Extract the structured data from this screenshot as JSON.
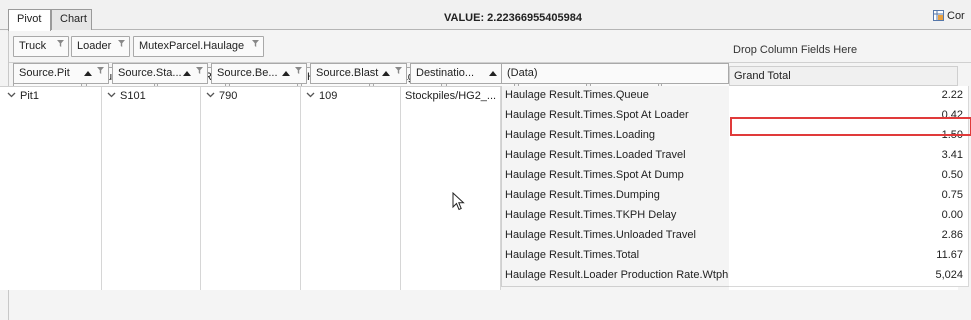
{
  "tabs": [
    {
      "label": "Pivot",
      "active": true
    },
    {
      "label": "Chart",
      "active": false
    }
  ],
  "value_label": "VALUE: 2.22366955405984",
  "config_button": "Cor",
  "filter_fields": [
    "Truck",
    "Loader",
    "MutexParcel.Haulage"
  ],
  "haulage_fields": [
    "HaulageR...",
    "HaulageR...",
    "HaulageR...",
    "HaulageR...",
    "HaulageR...",
    "HaulageR...",
    "HaulageR...",
    "HaulageR...",
    "HaulageR...",
    "HaulageR..."
  ],
  "drop_column_hint": "Drop Column Fields Here",
  "row_fields": [
    "Source.Pit",
    "Source.Sta...",
    "Source.Be...",
    "Source.Blast",
    "Destinatio..."
  ],
  "data_header": "(Data)",
  "grand_total_header": "Grand Total",
  "row_values": {
    "pit": "Pit1",
    "stage": "S101",
    "bench": "790",
    "blast": "109",
    "destination": "Stockpiles/HG2_..."
  },
  "data_rows": [
    {
      "label": "Haulage Result.Times.Queue",
      "value": "2.22"
    },
    {
      "label": "Haulage Result.Times.Spot At Loader",
      "value": "0.42"
    },
    {
      "label": "Haulage Result.Times.Loading",
      "value": "1.50"
    },
    {
      "label": "Haulage Result.Times.Loaded Travel",
      "value": "3.41"
    },
    {
      "label": "Haulage Result.Times.Spot At Dump",
      "value": "0.50"
    },
    {
      "label": "Haulage Result.Times.Dumping",
      "value": "0.75"
    },
    {
      "label": "Haulage Result.Times.TKPH Delay",
      "value": "0.00"
    },
    {
      "label": "Haulage Result.Times.Unloaded Travel",
      "value": "2.86"
    },
    {
      "label": "Haulage Result.Times.Total",
      "value": "11.67"
    },
    {
      "label": "Haulage Result.Loader Production Rate.Wtph",
      "value": "5,024"
    }
  ],
  "colors": {
    "selection_border": "#e03a3a",
    "border": "#a9a9a9",
    "background": "#f4f4f4"
  }
}
